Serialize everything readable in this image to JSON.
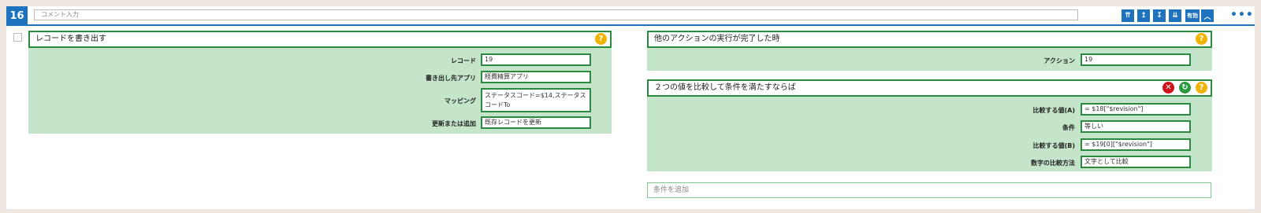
{
  "step_number": "16",
  "comment_placeholder": "コメント入力",
  "toolbar": {
    "btn1": "⇈",
    "btn2": "↥",
    "btn3": "↧",
    "btn4": "⇊",
    "enabled_label": "有効",
    "collapse": "︿",
    "more": "•••"
  },
  "left_block": {
    "title": "レコードを書き出す",
    "help": "?",
    "fields": [
      {
        "label": "レコード",
        "value": "19"
      },
      {
        "label": "書き出し先アプリ",
        "value": "経費精算アプリ"
      },
      {
        "label": "マッピング",
        "value": "ステータスコード=$14,ステータスコードTo"
      },
      {
        "label": "更新または追加",
        "value": "既存レコードを更新"
      }
    ]
  },
  "trigger_block": {
    "title": "他のアクションの実行が完了した時",
    "help": "?",
    "fields": [
      {
        "label": "アクション",
        "value": "19"
      }
    ]
  },
  "condition_block": {
    "title": "２つの値を比較して条件を満たすならば",
    "help": "?",
    "delete": "✕",
    "refresh": "↻",
    "fields": [
      {
        "label": "比較する値(A)",
        "value": "= $18[\"$revision\"]"
      },
      {
        "label": "条件",
        "value": "等しい"
      },
      {
        "label": "比較する値(B)",
        "value": "= $19[0][\"$revision\"]"
      },
      {
        "label": "数字の比較方法",
        "value": "文字として比較"
      }
    ]
  },
  "add_condition_placeholder": "条件を追加",
  "colors": {
    "accent": "#1e73be",
    "green_border": "#2b8a3e",
    "green_fill": "#c4e5c9",
    "help": "#f0b400",
    "delete": "#d0111b",
    "refresh": "#2b9a3e"
  }
}
